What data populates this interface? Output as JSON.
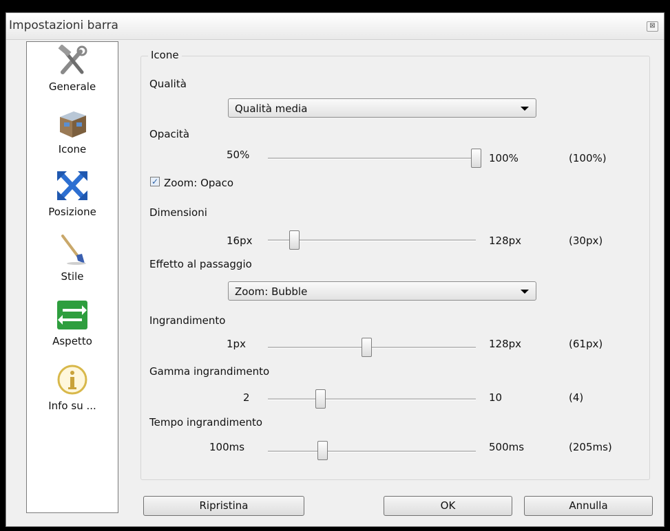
{
  "window": {
    "title": "Impostazioni barra",
    "close_glyph": "⊠"
  },
  "sidebar": {
    "items": [
      {
        "label": "Generale",
        "icon": "tools-icon"
      },
      {
        "label": "Icone",
        "icon": "box-icon"
      },
      {
        "label": "Posizione",
        "icon": "move-arrows-icon"
      },
      {
        "label": "Stile",
        "icon": "brush-icon"
      },
      {
        "label": "Aspetto",
        "icon": "swap-arrows-icon"
      },
      {
        "label": "Info su ...",
        "icon": "info-icon"
      }
    ],
    "selected": "Icone"
  },
  "group": {
    "title": "Icone"
  },
  "quality": {
    "label": "Qualità",
    "value": "Qualità media"
  },
  "opacity": {
    "label": "Opacità",
    "min": "50%",
    "max": "100%",
    "current": "(100%)",
    "fraction": 1.0
  },
  "zoom_checkbox": {
    "label": "Zoom: Opaco",
    "checked": true,
    "mark": "✓"
  },
  "dimensions": {
    "label": "Dimensioni",
    "min": "16px",
    "max": "128px",
    "current": "(30px)",
    "value": 30,
    "range": [
      16,
      128
    ]
  },
  "hover_effect": {
    "label": "Effetto al passaggio",
    "value": "Zoom: Bubble"
  },
  "magnification": {
    "label": "Ingrandimento",
    "min": "1px",
    "max": "128px",
    "current": "(61px)",
    "value": 61,
    "range": [
      1,
      128
    ]
  },
  "magnification_range": {
    "label": "Gamma ingrandimento",
    "min": "2",
    "max": "10",
    "current": "(4)",
    "value": 4,
    "range": [
      2,
      10
    ]
  },
  "magnification_time": {
    "label": "Tempo ingrandimento",
    "min": "100ms",
    "max": "500ms",
    "current": "(205ms)",
    "value": 205,
    "range": [
      100,
      500
    ]
  },
  "buttons": {
    "reset": "Ripristina",
    "ok": "OK",
    "cancel": "Annulla"
  },
  "colors": {
    "check": "#2a5fa5",
    "aspetto_icon": "#2e9e3e",
    "posizione_icon": "#2d6fd1",
    "info_icon": "#d8b84a"
  }
}
